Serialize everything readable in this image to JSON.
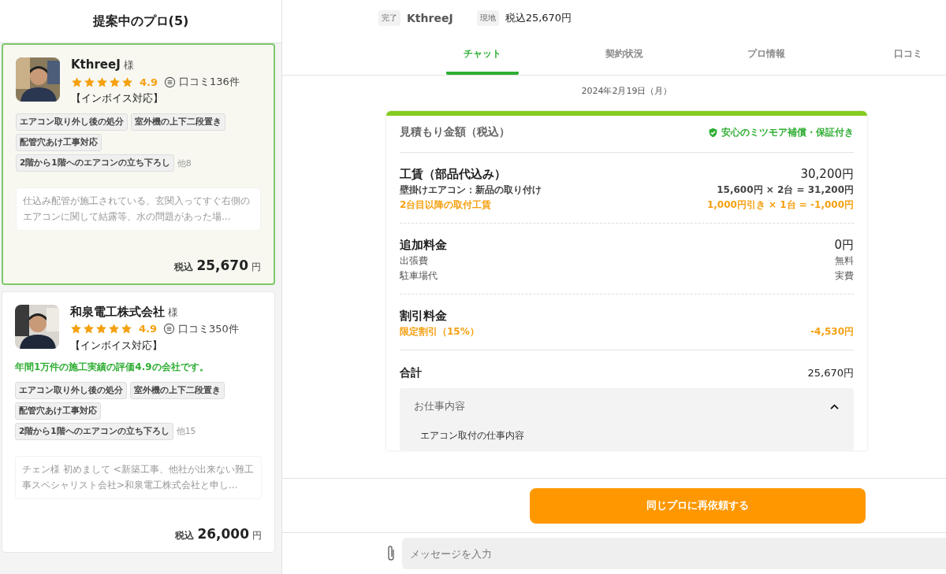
{
  "sidebar": {
    "title": "提案中のプロ(5)",
    "pros": [
      {
        "name": "KthreeJ",
        "honorific": "様",
        "stars": 5,
        "rating": "4.9",
        "reviews": "口コミ136件",
        "invoice": "【インボイス対応】",
        "selected": true,
        "tags": [
          "エアコン取り外し後の処分",
          "室外機の上下二段置き",
          "配管穴あけ工事対応",
          "2階から1階へのエアコンの立ち下ろし"
        ],
        "more": "他8",
        "message": "仕込み配管が施工されている、玄関入ってすぐ右側のエアコンに関して結露等、水の問題があった場...",
        "price_label": "税込",
        "price": "25,670",
        "currency": "円"
      },
      {
        "name": "和泉電工株式会社",
        "honorific": "様",
        "stars": 5,
        "rating": "4.9",
        "reviews": "口コミ350件",
        "invoice": "【インボイス対応】",
        "selected": false,
        "highlight": "年間1万件の施工実績の評価4.9の会社です。",
        "tags": [
          "エアコン取り外し後の処分",
          "室外機の上下二段置き",
          "配管穴あけ工事対応",
          "2階から1階へのエアコンの立ち下ろし"
        ],
        "more": "他15",
        "message": "チェン様 初めまして <新築工事、他社が出来ない難工事スペシャリスト会社>和泉電工株式会社と申し...",
        "price_label": "税込",
        "price": "26,000",
        "currency": "円"
      }
    ]
  },
  "header": {
    "status": "完了",
    "name": "KthreeJ",
    "location_badge": "現地",
    "amount": "税込25,670円"
  },
  "tabs": [
    {
      "label": "チャット",
      "selected": true
    },
    {
      "label": "契約状況",
      "selected": false
    },
    {
      "label": "プロ情報",
      "selected": false
    },
    {
      "label": "口コミ",
      "selected": false
    }
  ],
  "date": "2024年2月19日（月）",
  "estimate": {
    "title": "見積もり金額（税込）",
    "guarantee": "安心のミツモア補償・保証付き",
    "sections": [
      {
        "title": "工賃（部品代込み）",
        "amount": "30,200円",
        "lines": [
          {
            "label": "壁掛けエアコン：新品の取り付け",
            "value": "15,600円 × 2台 =  31,200円",
            "kind": "item"
          },
          {
            "label": "2台目以降の取付工賃",
            "value": "1,000円引き × 1台 =  -1,000円",
            "kind": "discount"
          }
        ]
      },
      {
        "title": "追加料金",
        "amount": "0円",
        "lines": [
          {
            "label": "出張費",
            "value": "無料",
            "kind": "plain"
          },
          {
            "label": "駐車場代",
            "value": "実費",
            "kind": "plain"
          }
        ]
      },
      {
        "title": "割引料金",
        "lines": [
          {
            "label": "限定割引（15%）",
            "value": "-4,530円",
            "kind": "discount"
          }
        ]
      }
    ],
    "total_label": "合計",
    "total": "25,670円",
    "details": {
      "title": "お仕事内容",
      "expanded": true,
      "item": "エアコン取付の仕事内容"
    }
  },
  "reorder_button": "同じプロに再依頼する",
  "message_input": {
    "placeholder": "メッセージを入力"
  }
}
